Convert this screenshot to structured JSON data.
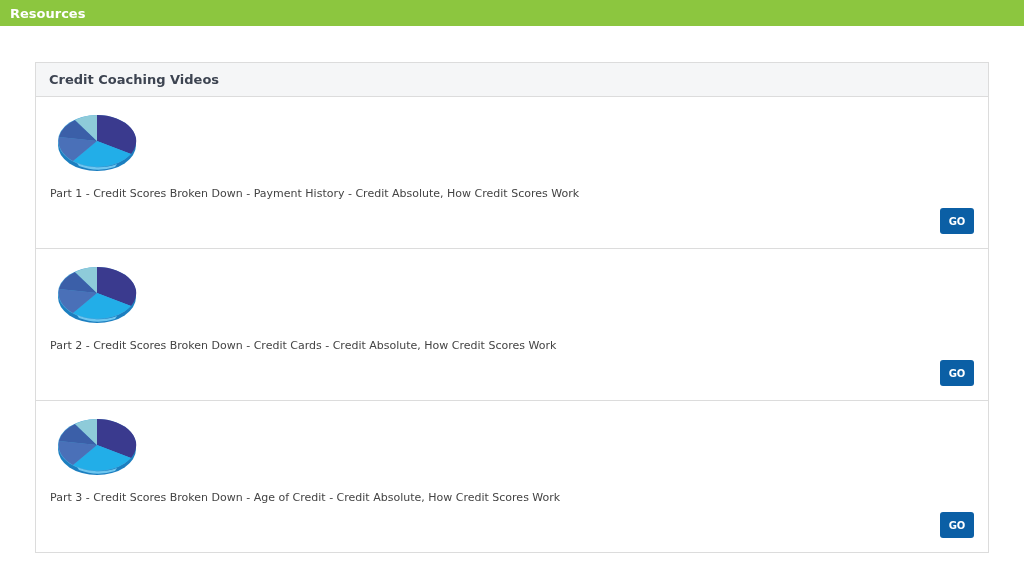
{
  "header": {
    "title": "Resources"
  },
  "panel": {
    "title": "Credit Coaching Videos",
    "videos": [
      {
        "caption": "Part 1 - Credit Scores Broken Down - Payment History - Credit Absolute, How Credit Scores Work",
        "button": "GO"
      },
      {
        "caption": "Part 2 - Credit Scores Broken Down - Credit Cards - Credit Absolute, How Credit Scores Work",
        "button": "GO"
      },
      {
        "caption": "Part 3 - Credit Scores Broken Down - Age of Credit - Credit Absolute, How Credit Scores Work",
        "button": "GO"
      }
    ]
  }
}
